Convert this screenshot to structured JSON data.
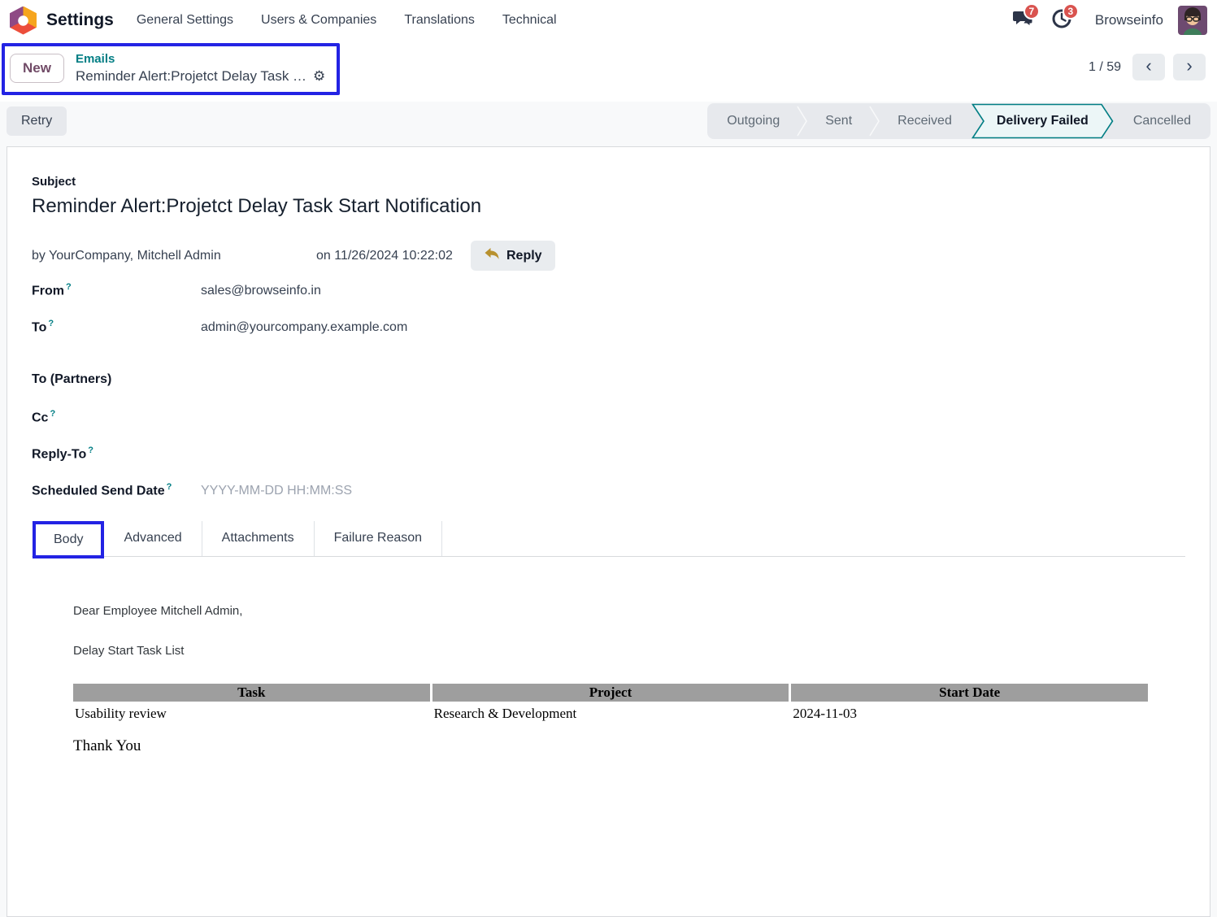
{
  "colors": {
    "accent_teal": "#017e84",
    "highlight_blue": "#2323e4",
    "badge_red": "#d9534f",
    "table_header_gray": "#9e9e9e",
    "brand_purple": "#714b67"
  },
  "icons": {
    "gear": "⚙",
    "prev_chevron": "‹",
    "next_chevron": "›",
    "help_symbol": "?"
  },
  "navbar": {
    "app_name": "Settings",
    "menu": [
      "General Settings",
      "Users & Companies",
      "Translations",
      "Technical"
    ],
    "messages_badge": "7",
    "activities_badge": "3",
    "user_name": "Browseinfo"
  },
  "breadcrumb": {
    "new_button": "New",
    "parent_link": "Emails",
    "current_title": "Reminder Alert:Projetct Delay Task …"
  },
  "pager": {
    "counter": "1 / 59"
  },
  "statusbar": {
    "retry_button": "Retry",
    "stages": [
      "Outgoing",
      "Sent",
      "Received",
      "Delivery Failed",
      "Cancelled"
    ],
    "active_stage": "Delivery Failed"
  },
  "form": {
    "subject_label": "Subject",
    "subject_value": "Reminder Alert:Projetct Delay Task Start Notification",
    "author_line": "by YourCompany, Mitchell Admin",
    "date_line": "on 11/26/2024 10:22:02",
    "reply_button": "Reply",
    "fields": {
      "from": {
        "label": "From",
        "value": "sales@browseinfo.in"
      },
      "to": {
        "label": "To",
        "value": "admin@yourcompany.example.com"
      },
      "to_partners": {
        "label": "To (Partners)",
        "value": ""
      },
      "cc": {
        "label": "Cc",
        "value": ""
      },
      "reply_to": {
        "label": "Reply-To",
        "value": ""
      },
      "scheduled_send_date": {
        "label": "Scheduled Send Date",
        "placeholder": "YYYY-MM-DD HH:MM:SS"
      }
    }
  },
  "notebook": {
    "tabs": [
      "Body",
      "Advanced",
      "Attachments",
      "Failure Reason"
    ],
    "active_tab": "Body"
  },
  "email_body": {
    "greeting": "Dear Employee Mitchell Admin,",
    "intro": "Delay Start Task List",
    "table": {
      "headers": [
        "Task",
        "Project",
        "Start Date"
      ],
      "rows": [
        {
          "task": "Usability review",
          "project": "Research & Development",
          "start_date": "2024-11-03"
        }
      ]
    },
    "closing": "Thank You"
  }
}
